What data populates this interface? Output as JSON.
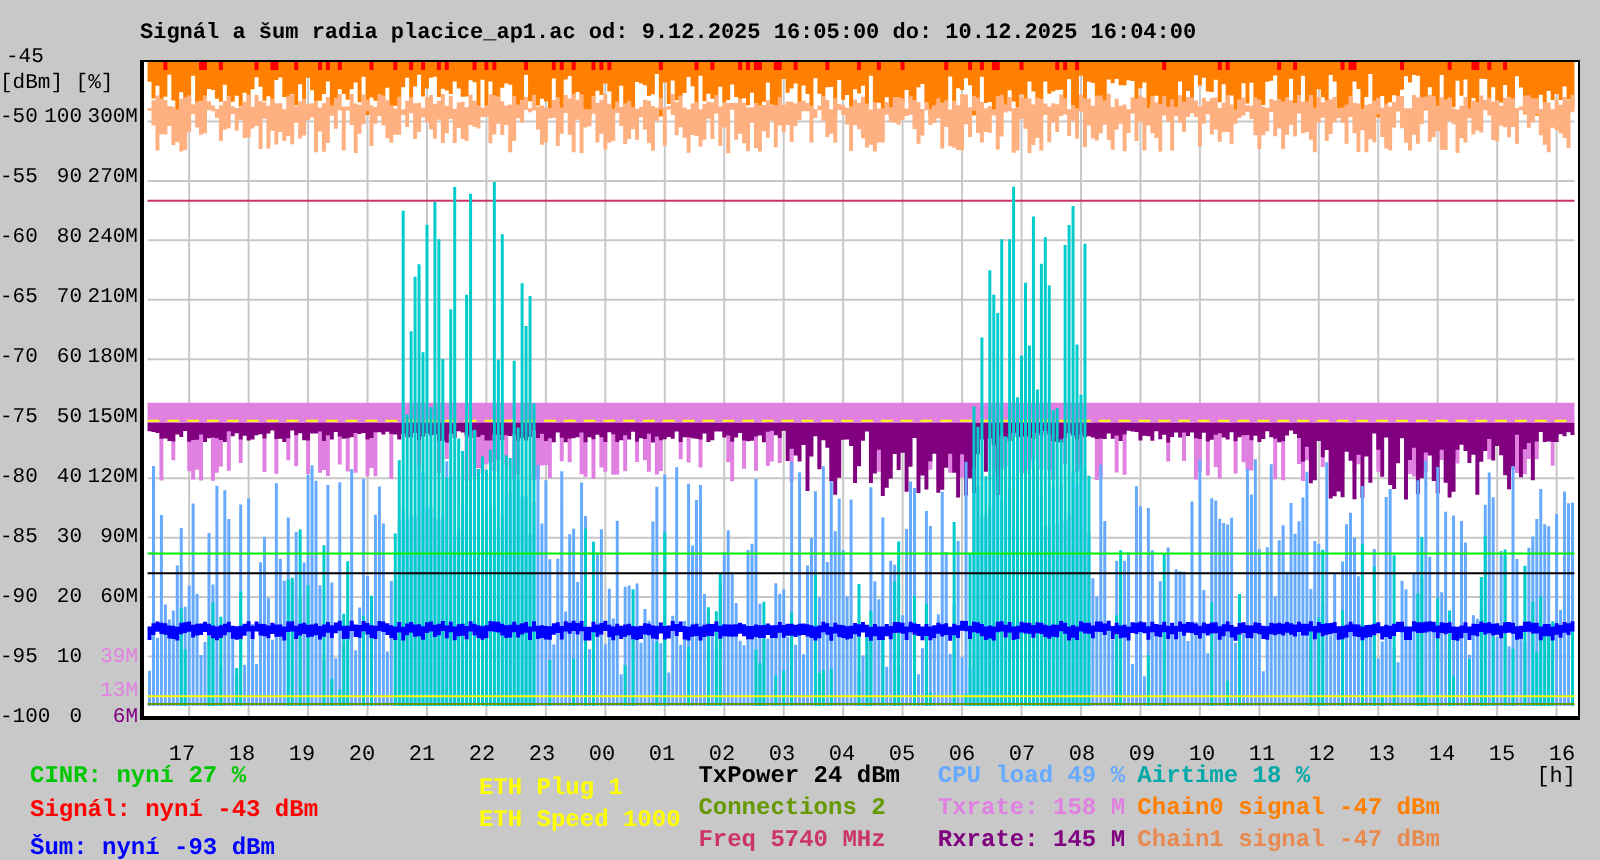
{
  "title": "Signál a šum radia placice_ap1.ac od: 9.12.2025 16:05:00 do: 10.12.2025 16:04:00",
  "y_axis": {
    "unit_label": "[dBm] [%]",
    "ticks": [
      {
        "dbm": "-45"
      },
      {
        "dbm": "-50",
        "pct": "100",
        "rates": [
          {
            "text": "300M",
            "color": "#000000"
          }
        ]
      },
      {
        "dbm": "-55",
        "pct": "90",
        "rates": [
          {
            "text": "270M",
            "color": "#000000"
          }
        ]
      },
      {
        "dbm": "-60",
        "pct": "80",
        "rates": [
          {
            "text": "240M",
            "color": "#000000"
          }
        ]
      },
      {
        "dbm": "-65",
        "pct": "70",
        "rates": [
          {
            "text": "210M",
            "color": "#000000"
          }
        ]
      },
      {
        "dbm": "-70",
        "pct": "60",
        "rates": [
          {
            "text": "180M",
            "color": "#000000"
          }
        ]
      },
      {
        "dbm": "-75",
        "pct": "50",
        "rates": [
          {
            "text": "150M",
            "color": "#000000"
          }
        ]
      },
      {
        "dbm": "-80",
        "pct": "40",
        "rates": [
          {
            "text": "120M",
            "color": "#000000"
          }
        ]
      },
      {
        "dbm": "-85",
        "pct": "30",
        "rates": [
          {
            "text": "90M",
            "color": "#000000"
          }
        ]
      },
      {
        "dbm": "-90",
        "pct": "20",
        "rates": [
          {
            "text": "60M",
            "color": "#000000"
          }
        ]
      },
      {
        "dbm": "-95",
        "pct": "10",
        "rates": [
          {
            "text": "39M",
            "color": "#e080e0"
          }
        ]
      },
      {
        "dbm": "-100",
        "pct": "0",
        "rates": [
          {
            "text": "13M",
            "color": "#e080e0"
          },
          {
            "text": "6M",
            "color": "#800080"
          }
        ]
      }
    ]
  },
  "x_axis": {
    "labels": [
      "17",
      "18",
      "19",
      "20",
      "21",
      "22",
      "23",
      "00",
      "01",
      "02",
      "03",
      "04",
      "05",
      "06",
      "07",
      "08",
      "09",
      "10",
      "11",
      "12",
      "13",
      "14",
      "15",
      "16"
    ],
    "unit": "[h]"
  },
  "legend": [
    {
      "items": [
        {
          "text": "CINR: nyní 27 %",
          "color": "#00c800"
        },
        {
          "text": "Signál: nyní -43 dBm",
          "color": "#ff0000"
        },
        {
          "text": "Šum: nyní -93 dBm",
          "color": "#0000ff"
        }
      ]
    },
    {
      "items": [
        {
          "text": "ETH Plug 1",
          "color": "#ffff00"
        },
        {
          "text": "ETH Speed 1000",
          "color": "#ffff00"
        }
      ]
    },
    {
      "items": [
        {
          "text": "TxPower 24 dBm",
          "color": "#000000"
        },
        {
          "text": "Connections 2",
          "color": "#669900"
        },
        {
          "text": "Freq 5740 MHz",
          "color": "#cc3366"
        }
      ]
    },
    {
      "items": [
        {
          "text": "CPU load 49 %",
          "color": "#66aaff"
        },
        {
          "text": "Txrate: 158 M",
          "color": "#e080e0"
        },
        {
          "text": "Rxrate: 145 M",
          "color": "#800080"
        }
      ]
    },
    {
      "items": [
        {
          "text": "Airtime 18 %",
          "color": "#00a8a8"
        },
        {
          "text": "Chain0 signal -47 dBm",
          "color": "#ff8000"
        },
        {
          "text": "Chain1 signal -47 dBm",
          "color": "#e88a50"
        }
      ]
    }
  ]
}
